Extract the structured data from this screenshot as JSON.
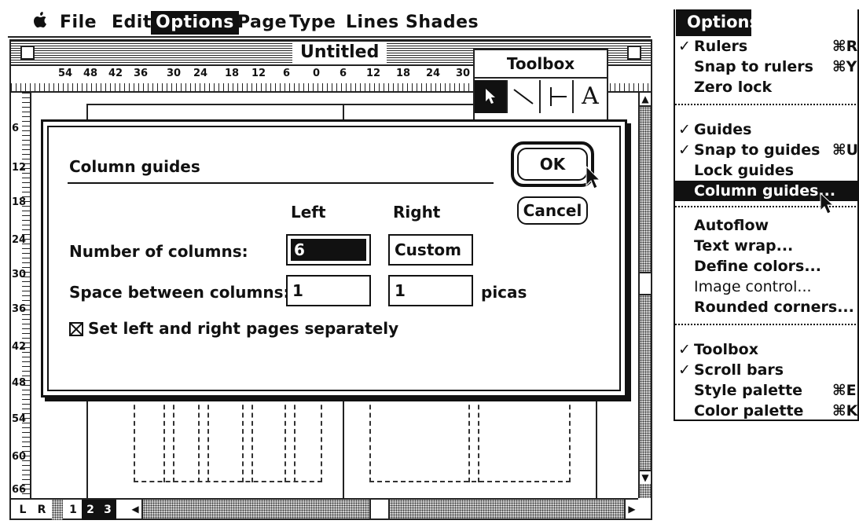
{
  "menubar": {
    "apple_icon": "apple-icon",
    "items": [
      "File",
      "Edit",
      "Options",
      "Page",
      "Type",
      "Lines",
      "Shades"
    ],
    "active": "Options"
  },
  "window": {
    "title": "Untitled",
    "ruler_top_numbers": [
      "54",
      "48",
      "42",
      "36",
      "30",
      "24",
      "18",
      "12",
      "6",
      "0",
      "6",
      "12",
      "18",
      "24",
      "30"
    ],
    "ruler_left_numbers": [
      "6",
      "12",
      "18",
      "24",
      "30",
      "36",
      "42",
      "48",
      "54",
      "60",
      "66"
    ],
    "page_buttons": [
      "L",
      "R",
      "1",
      "2",
      "3"
    ],
    "active_pages": [
      "2",
      "3"
    ]
  },
  "toolbox": {
    "title": "Toolbox",
    "tools": [
      "pointer-tool-icon",
      "diagonal-line-tool-icon",
      "perpendicular-line-tool-icon",
      "text-tool-icon"
    ],
    "text_tool_glyph": "A"
  },
  "dialog": {
    "title": "Column guides",
    "col_left": "Left",
    "col_right": "Right",
    "row_columns_label": "Number of columns:",
    "row_columns_left": "6",
    "row_columns_right": "Custom",
    "row_space_label": "Space between columns:",
    "row_space_left": "1",
    "row_space_right": "1",
    "unit": "picas",
    "checkbox_label": "Set left and right pages separately",
    "checkbox_checked": true,
    "ok": "OK",
    "cancel": "Cancel"
  },
  "options_menu": {
    "title": "Options",
    "groups": [
      [
        {
          "label": "Rulers",
          "checked": true,
          "shortcut": "⌘R"
        },
        {
          "label": "Snap to rulers",
          "checked": false,
          "shortcut": "⌘Y"
        },
        {
          "label": "Zero lock",
          "checked": false,
          "shortcut": ""
        }
      ],
      [
        {
          "label": "Guides",
          "checked": true,
          "shortcut": ""
        },
        {
          "label": "Snap to guides",
          "checked": true,
          "shortcut": "⌘U"
        },
        {
          "label": "Lock guides",
          "checked": false,
          "shortcut": ""
        },
        {
          "label": "Column guides...",
          "checked": false,
          "shortcut": "",
          "highlighted": true
        }
      ],
      [
        {
          "label": "Autoflow",
          "checked": false,
          "shortcut": ""
        },
        {
          "label": "Text wrap...",
          "checked": false,
          "shortcut": ""
        },
        {
          "label": "Define colors...",
          "checked": false,
          "shortcut": ""
        },
        {
          "label": "Image control...",
          "checked": false,
          "shortcut": ""
        },
        {
          "label": "Rounded corners...",
          "checked": false,
          "shortcut": ""
        }
      ],
      [
        {
          "label": "Toolbox",
          "checked": true,
          "shortcut": ""
        },
        {
          "label": "Scroll bars",
          "checked": true,
          "shortcut": ""
        },
        {
          "label": "Style palette",
          "checked": false,
          "shortcut": "⌘E"
        },
        {
          "label": "Color palette",
          "checked": false,
          "shortcut": "⌘K"
        }
      ]
    ]
  }
}
